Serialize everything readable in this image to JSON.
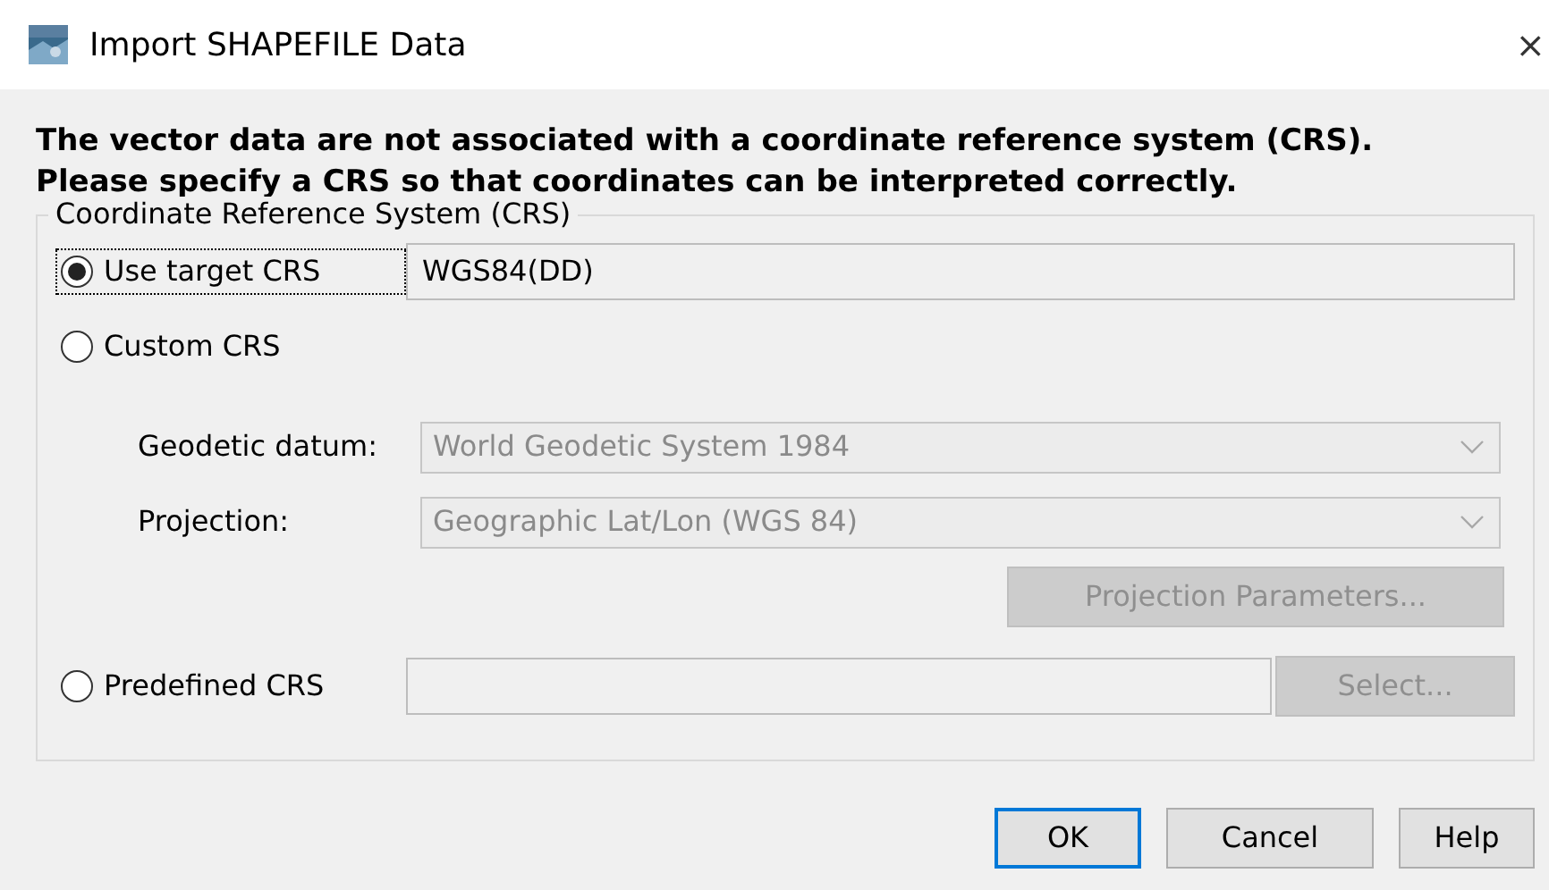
{
  "window": {
    "title": "Import SHAPEFILE Data",
    "close": "×"
  },
  "message": "The vector data are not associated with a coordinate reference system (CRS).\nPlease specify a CRS so that coordinates can be interpreted correctly.",
  "crs_group": {
    "legend": "Coordinate Reference System (CRS)",
    "options": [
      {
        "kind": "target",
        "label": "Use target CRS",
        "selected": true,
        "focused": true,
        "value": "WGS84(DD)"
      },
      {
        "kind": "custom",
        "label": "Custom CRS",
        "selected": false,
        "focused": false
      },
      {
        "kind": "predefined",
        "label": "Predefined CRS",
        "selected": false,
        "focused": false
      }
    ],
    "geodetic_datum": {
      "label": "Geodetic datum:",
      "value": "World Geodetic System 1984",
      "disabled": true
    },
    "projection": {
      "label": "Projection:",
      "value": "Geographic Lat/Lon (WGS 84)",
      "disabled": true
    },
    "projection_parameters_button": {
      "label": "Projection Parameters...",
      "disabled": true
    },
    "select_button": {
      "label": "Select...",
      "disabled": true
    }
  },
  "buttons": [
    {
      "label": "OK",
      "default": true
    },
    {
      "label": "Cancel",
      "default": false
    },
    {
      "label": "Help",
      "default": false
    }
  ]
}
